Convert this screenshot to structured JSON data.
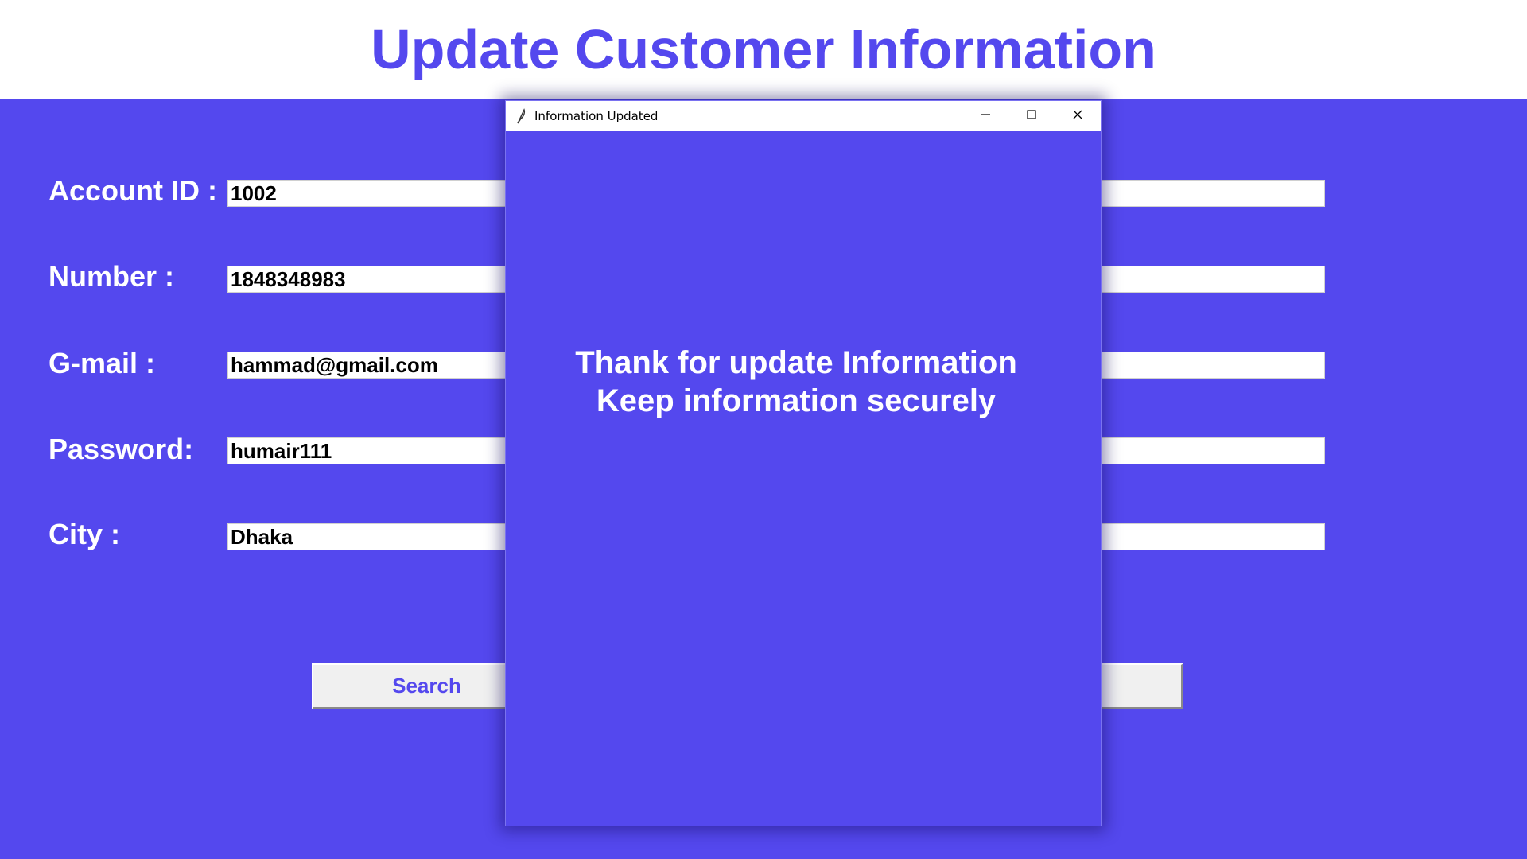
{
  "header": {
    "title": "Update Customer Information"
  },
  "form": {
    "fields": [
      {
        "label": "Account ID :",
        "value": "1002"
      },
      {
        "label": "Number :",
        "value": "1848348983"
      },
      {
        "label": "G-mail :",
        "value": "hammad@gmail.com"
      },
      {
        "label": "Password:",
        "value": "humair111"
      },
      {
        "label": "City :",
        "value": "Dhaka"
      }
    ],
    "search_label": "Search",
    "update_label": ""
  },
  "dialog": {
    "title": "Information Updated",
    "icon": "feather-icon",
    "controls": [
      "minimize-icon",
      "maximize-icon",
      "close-icon"
    ],
    "message_line1": "Thank for update Information",
    "message_line2": "Keep information securely"
  },
  "colors": {
    "accent": "#5448ee",
    "background": "#ffffff",
    "button_face": "#f0f0f0"
  }
}
